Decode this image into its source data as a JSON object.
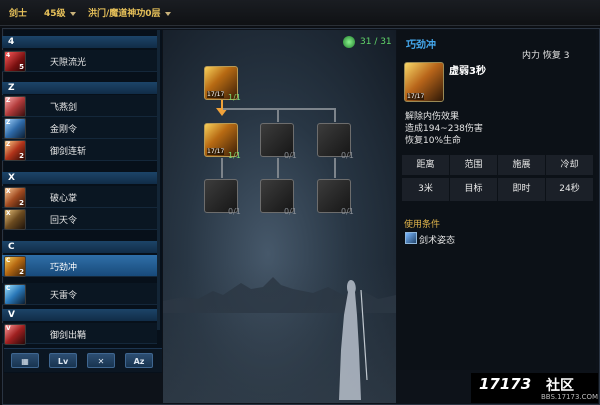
{
  "topbar": {
    "class": "剑士",
    "level": "45级",
    "school": "洪门/魔道神功0层"
  },
  "skill_list": {
    "sections": [
      {
        "key": "4",
        "skills": [
          {
            "key": "4",
            "name": "天隙流光",
            "count": "5"
          }
        ]
      },
      {
        "key": "Z",
        "skills": [
          {
            "key": "Z",
            "name": "飞燕剑",
            "count": ""
          },
          {
            "key": "Z",
            "name": "金刚令",
            "count": ""
          },
          {
            "key": "Z",
            "name": "御剑连斩",
            "count": "2"
          }
        ]
      },
      {
        "key": "X",
        "skills": [
          {
            "key": "X",
            "name": "破心掌",
            "count": "2"
          },
          {
            "key": "X",
            "name": "回天令",
            "count": ""
          }
        ]
      },
      {
        "key": "C",
        "skills": [
          {
            "key": "C",
            "name": "巧劲冲",
            "count": "2"
          },
          {
            "key": "C",
            "name": "天雷令",
            "count": ""
          }
        ]
      },
      {
        "key": "V",
        "skills": [
          {
            "key": "V",
            "name": "御剑出鞘",
            "count": ""
          }
        ]
      }
    ],
    "selected": "巧劲冲"
  },
  "bottom_buttons": [
    "▦",
    "Lv",
    "✕",
    "Az"
  ],
  "tree": {
    "points": "31 / 31",
    "nodes": [
      {
        "level": "17/17",
        "count": "1/1",
        "state": "active"
      },
      {
        "level": "17/17",
        "count": "1/1",
        "state": "active"
      },
      {
        "level": "",
        "count": "0/1",
        "state": "dim"
      },
      {
        "level": "",
        "count": "0/1",
        "state": "dim"
      },
      {
        "level": "",
        "count": "0/1",
        "state": "dim"
      },
      {
        "level": "",
        "count": "0/1",
        "state": "dim"
      },
      {
        "level": "",
        "count": "0/1",
        "state": "dim"
      }
    ]
  },
  "detail": {
    "name": "巧劲冲",
    "cost": "内力 恢复 3",
    "icon_level": "17/17",
    "state": "虚弱3秒",
    "desc": [
      "解除内伤效果",
      "造成194~238伤害",
      "恢复10%生命"
    ],
    "stats_headers": [
      "距离",
      "范围",
      "施展",
      "冷却"
    ],
    "stats_values": [
      "3米",
      "目标",
      "即时",
      "24秒"
    ],
    "req_title": "使用条件",
    "req_item": "剑术姿态"
  },
  "watermark": {
    "logo": "17173",
    "brand": "社区",
    "url": "BBS.17173.COM"
  },
  "colors": {
    "accent_gold": "#e8c25a",
    "skill_name": "#45a9ee",
    "points_green": "#62d56a",
    "selected_row": "#2f6fa8"
  }
}
